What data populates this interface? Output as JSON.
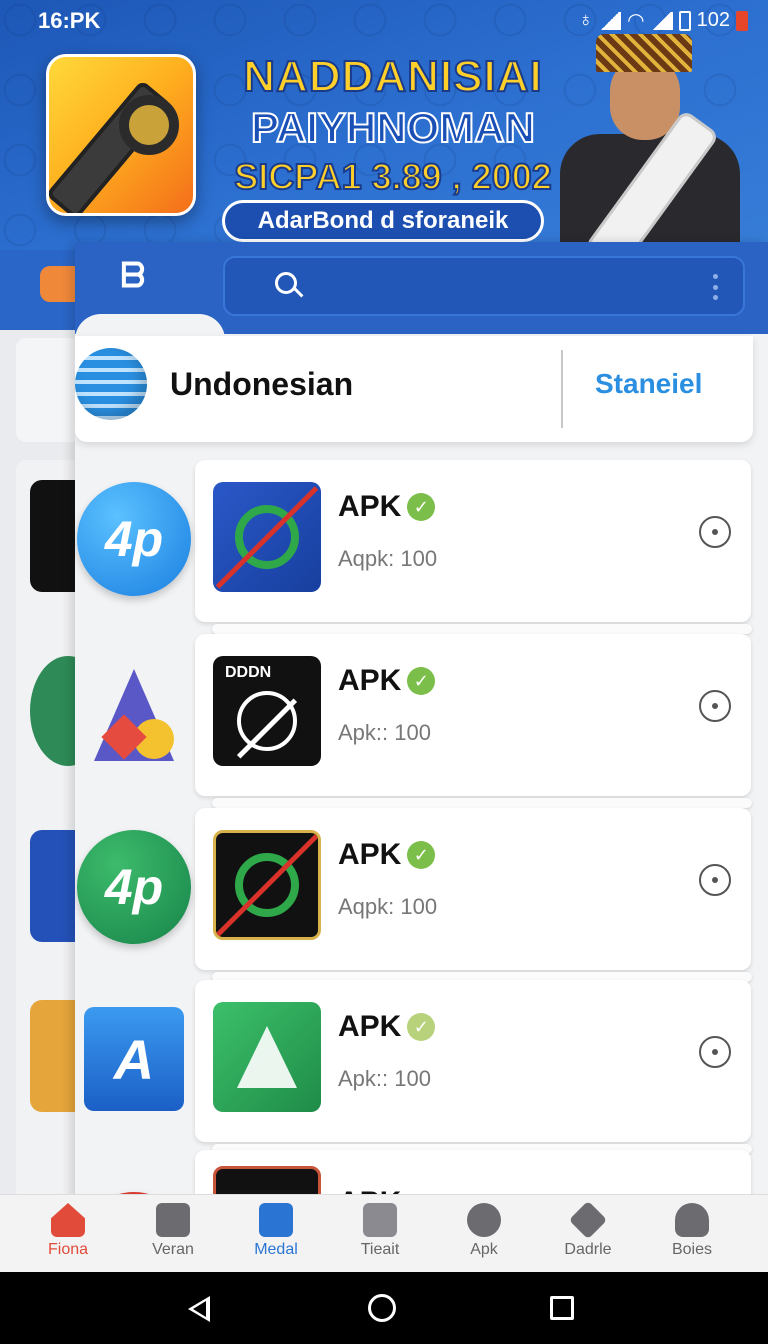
{
  "status_bar": {
    "time": "16:PK",
    "battery": "102"
  },
  "banner": {
    "title_line1": "NADDANISIAI",
    "title_line2": "PAIYHNOMAN",
    "title_line3": "SICPA1 3.89 , 2002",
    "pill": "AdarBond d sforaneik"
  },
  "language": {
    "name": "Undonesian",
    "action": "Staneiel"
  },
  "items": [
    {
      "left_icon_text": "4p",
      "tile_label": "",
      "title": "APK",
      "sub": "Aqpk: 100"
    },
    {
      "left_icon_text": "",
      "tile_label": "DDDN",
      "title": "APK",
      "sub": "Apk:: 100"
    },
    {
      "left_icon_text": "4p",
      "tile_label": "",
      "title": "APK",
      "sub": "Aqpk: 100"
    },
    {
      "left_icon_text": "A",
      "tile_label": "",
      "title": "APK",
      "sub": "Apk:: 100"
    },
    {
      "left_icon_text": "",
      "tile_label": "",
      "title": "APK",
      "sub": ""
    }
  ],
  "bottom_nav": [
    {
      "label": "Fiona",
      "icon": "home-icon"
    },
    {
      "label": "Veran",
      "icon": "card-icon"
    },
    {
      "label": "Medal",
      "icon": "check-badge-icon"
    },
    {
      "label": "Tieait",
      "icon": "chat-icon"
    },
    {
      "label": "Apk",
      "icon": "globe-icon"
    },
    {
      "label": "Dadrle",
      "icon": "tag-icon"
    },
    {
      "label": "Boies",
      "icon": "user-icon"
    }
  ],
  "colors": {
    "accent": "#2a63c4",
    "verified": "#7bbf4a",
    "home_active": "#e04b3a",
    "medal_active": "#2a75d4"
  }
}
